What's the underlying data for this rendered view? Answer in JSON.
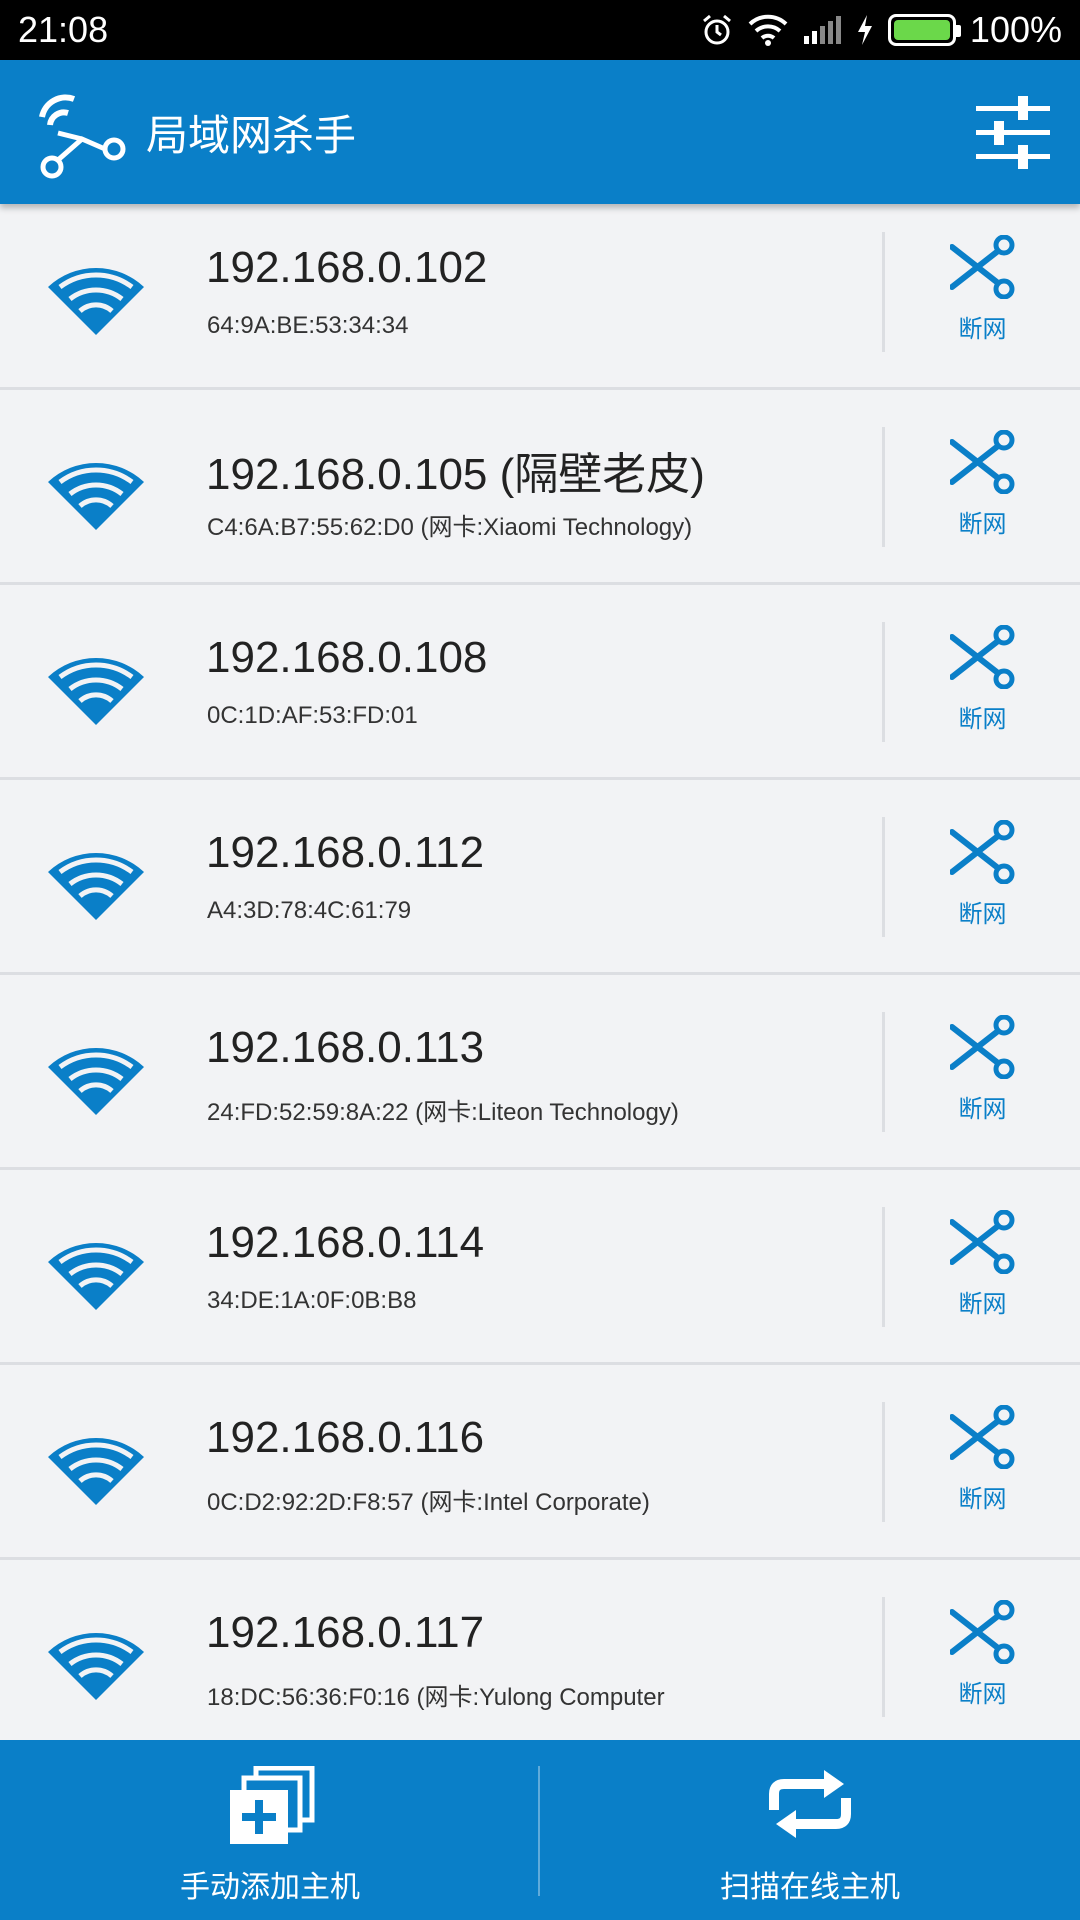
{
  "status_bar": {
    "time": "21:08",
    "battery_pct": "100%",
    "battery_level": 1.0
  },
  "app_bar": {
    "title": "局域网杀手"
  },
  "hosts": [
    {
      "ip": "",
      "mac": "",
      "cut_label": "断网"
    },
    {
      "ip": "192.168.0.102",
      "mac": "64:9A:BE:53:34:34",
      "cut_label": "断网"
    },
    {
      "ip": "192.168.0.105 (隔壁老皮)",
      "mac": "C4:6A:B7:55:62:D0 (网卡:Xiaomi Technology)",
      "cut_label": "断网"
    },
    {
      "ip": "192.168.0.108",
      "mac": "0C:1D:AF:53:FD:01",
      "cut_label": "断网"
    },
    {
      "ip": "192.168.0.112",
      "mac": "A4:3D:78:4C:61:79",
      "cut_label": "断网"
    },
    {
      "ip": "192.168.0.113",
      "mac": "24:FD:52:59:8A:22 (网卡:Liteon Technology)",
      "cut_label": "断网"
    },
    {
      "ip": "192.168.0.114",
      "mac": "34:DE:1A:0F:0B:B8",
      "cut_label": "断网"
    },
    {
      "ip": "192.168.0.116",
      "mac": "0C:D2:92:2D:F8:57 (网卡:Intel Corporate)",
      "cut_label": "断网"
    },
    {
      "ip": "192.168.0.117",
      "mac": "18:DC:56:36:F0:16 (网卡:Yulong Computer",
      "cut_label": "断网"
    }
  ],
  "bottom_bar": {
    "add_label": "手动添加主机",
    "scan_label": "扫描在线主机"
  },
  "colors": {
    "primary": "#0a7fc8",
    "background": "#f2f3f5",
    "divider": "#dcdee2",
    "battery": "#6bd84a"
  }
}
